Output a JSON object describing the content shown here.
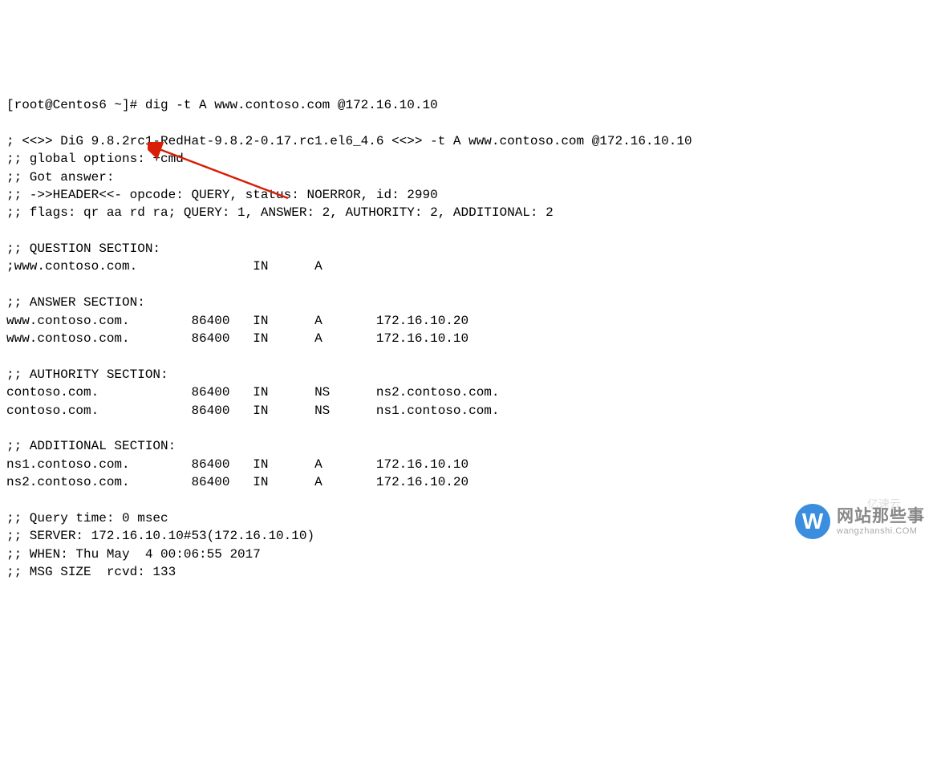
{
  "terminal": {
    "prompt": "[root@Centos6 ~]# ",
    "command": "dig -t A www.contoso.com @172.16.10.10",
    "dig_header": "; <<>> DiG 9.8.2rc1-RedHat-9.8.2-0.17.rc1.el6_4.6 <<>> -t A www.contoso.com @172.16.10.10",
    "global_options": ";; global options: +cmd",
    "got_answer": ";; Got answer:",
    "header_line": ";; ->>HEADER<<- opcode: QUERY, status: NOERROR, id: 2990",
    "flags_line": ";; flags: qr aa rd ra; QUERY: 1, ANSWER: 2, AUTHORITY: 2, ADDITIONAL: 2",
    "question_header": ";; QUESTION SECTION:",
    "question_line": ";www.contoso.com.               IN      A",
    "answer_header": ";; ANSWER SECTION:",
    "answer_lines": [
      "www.contoso.com.        86400   IN      A       172.16.10.20",
      "www.contoso.com.        86400   IN      A       172.16.10.10"
    ],
    "authority_header": ";; AUTHORITY SECTION:",
    "authority_lines": [
      "contoso.com.            86400   IN      NS      ns2.contoso.com.",
      "contoso.com.            86400   IN      NS      ns1.contoso.com."
    ],
    "additional_header": ";; ADDITIONAL SECTION:",
    "additional_lines": [
      "ns1.contoso.com.        86400   IN      A       172.16.10.10",
      "ns2.contoso.com.        86400   IN      A       172.16.10.20"
    ],
    "query_time": ";; Query time: 0 msec",
    "server": ";; SERVER: 172.16.10.10#53(172.16.10.10)",
    "when": ";; WHEN: Thu May  4 00:06:55 2017",
    "msg_size": ";; MSG SIZE  rcvd: 133"
  },
  "watermark": {
    "icon_letter": "W",
    "text_top": "网站那些事",
    "text_bottom": "wangzhanshi.COM",
    "yiyun": "亿速云"
  }
}
